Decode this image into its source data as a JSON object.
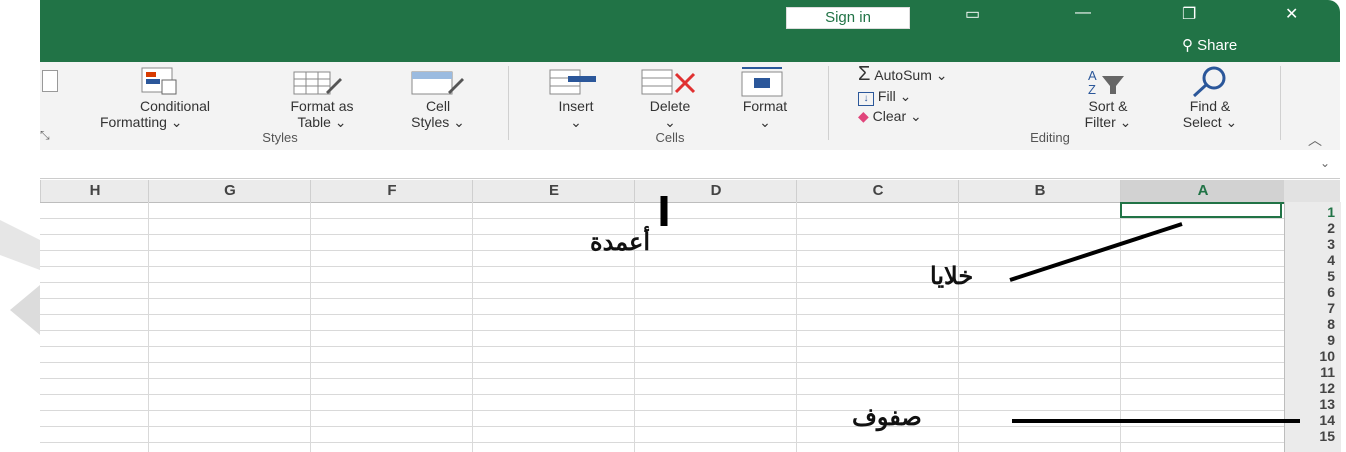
{
  "titlebar": {
    "sign_in": "Sign in",
    "share": "Share",
    "controls": [
      "ribbon-display-icon",
      "minimize-icon",
      "restore-icon",
      "close-icon"
    ]
  },
  "ribbon": {
    "styles": {
      "conditional_formatting": [
        "Conditional",
        "Formatting ⌄"
      ],
      "format_as_table": [
        "Format as",
        "Table ⌄"
      ],
      "cell_styles": [
        "Cell",
        "Styles ⌄"
      ],
      "group_label": "Styles"
    },
    "cells": {
      "insert": [
        "Insert",
        "⌄"
      ],
      "delete": [
        "Delete",
        "⌄"
      ],
      "format": [
        "Format",
        "⌄"
      ],
      "group_label": "Cells"
    },
    "editing": {
      "autosum": "AutoSum ⌄",
      "fill": "Fill ⌄",
      "clear": "Clear ⌄",
      "sort_filter": [
        "Sort &",
        "Filter ⌄"
      ],
      "find_select": [
        "Find &",
        "Select ⌄"
      ],
      "group_label": "Editing"
    }
  },
  "grid": {
    "columns": [
      "H",
      "G",
      "F",
      "E",
      "D",
      "C",
      "B",
      "A"
    ],
    "rows": [
      "1",
      "2",
      "3",
      "4",
      "5",
      "6",
      "7",
      "8",
      "9",
      "10",
      "11",
      "12",
      "13",
      "14",
      "15"
    ],
    "selected_column": "A",
    "selected_row": "1"
  },
  "annotations": {
    "columns": "أعمدة",
    "cells": "خلايا",
    "rows": "صفوف"
  },
  "colors": {
    "accent": "#217346",
    "ribbon": "#f3f3f3"
  }
}
